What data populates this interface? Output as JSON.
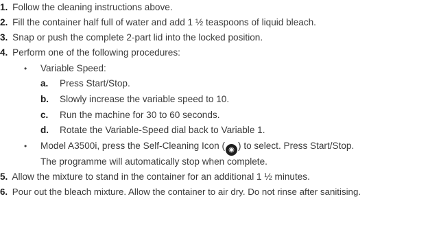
{
  "steps": [
    {
      "num": "1.",
      "text": "Follow the cleaning instructions above."
    },
    {
      "num": "2.",
      "text": "Fill the container half full of water and add 1 ½ teaspoons of liquid bleach."
    },
    {
      "num": "3.",
      "text": "Snap or push the complete 2-part lid into the locked position."
    },
    {
      "num": "4.",
      "text": "Perform one of the following procedures:"
    },
    {
      "num": "5.",
      "text": "Allow the mixture to stand in the container for an additional 1 ½ minutes."
    },
    {
      "num": "6.",
      "text": "Pour out the bleach mixture. Allow the container to air dry. Do not rinse after sanitising."
    }
  ],
  "bullet_glyph": "•",
  "variable_speed": {
    "label": "Variable Speed:",
    "substeps": [
      {
        "letter": "a.",
        "text": "Press Start/Stop."
      },
      {
        "letter": "b.",
        "text": "Slowly increase the variable speed to 10."
      },
      {
        "letter": "c.",
        "text": "Run the machine for 30 to 60 seconds."
      },
      {
        "letter": "d.",
        "text": "Rotate the Variable-Speed dial back to Variable 1."
      }
    ]
  },
  "a3500i": {
    "before_icon": "Model A3500i, press the Self-Cleaning Icon (",
    "after_icon": ") to select. Press Start/Stop.",
    "line2": "The programme will automatically stop when complete.",
    "icon_name": "self-cleaning-icon"
  }
}
